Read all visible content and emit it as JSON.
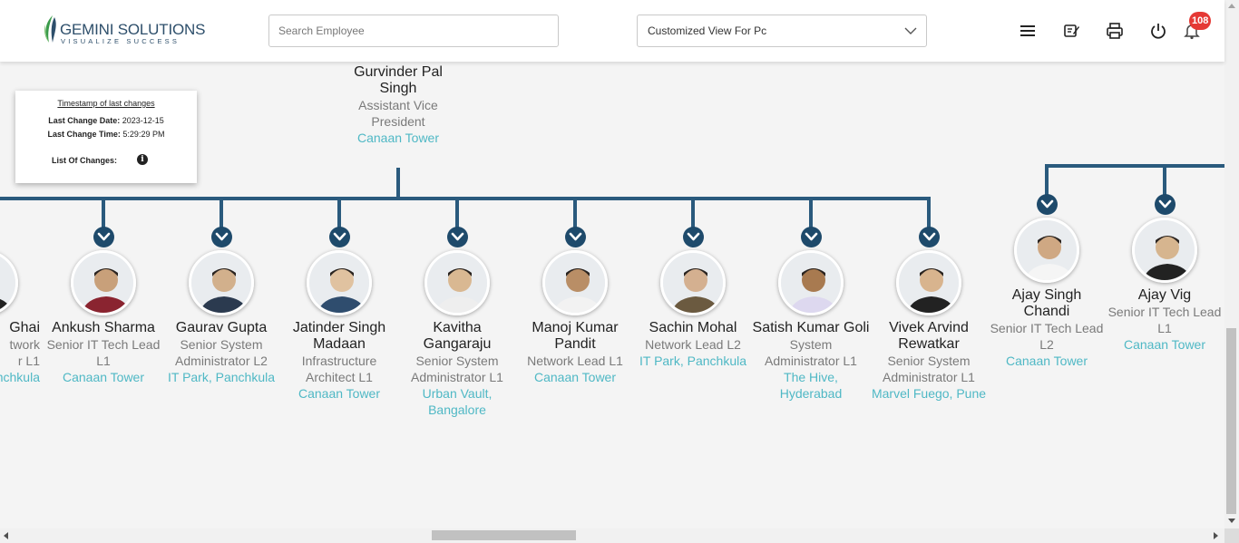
{
  "header": {
    "logo_main": "GEMINI SOLUTIONS",
    "logo_sub": "VISUALIZE SUCCESS",
    "search_placeholder": "Search Employee",
    "view_select": "Customized View For Pc",
    "notification_count": "108",
    "icons": [
      "menu-icon",
      "edit-note-icon",
      "print-icon",
      "power-icon",
      "bell-icon"
    ]
  },
  "timestamp": {
    "title": "Timestamp of last changes",
    "date_label": "Last Change Date:",
    "date_value": "2023-12-15",
    "time_label": "Last Change Time:",
    "time_value": "5:29:29 PM",
    "changes_label": "List Of Changes:"
  },
  "manager": {
    "name": "Gurvinder Pal Singh",
    "title": "Assistant Vice President",
    "location": "Canaan Tower"
  },
  "reports": [
    {
      "name": "Ghai",
      "title": "twork",
      "title2": "r L1",
      "location": "nchkula"
    },
    {
      "name": "Ankush Sharma",
      "title": "Senior IT Tech Lead L1",
      "location": "Canaan Tower"
    },
    {
      "name": "Gaurav Gupta",
      "title": "Senior System Administrator L2",
      "location": "IT Park, Panchkula"
    },
    {
      "name": "Jatinder Singh Madaan",
      "title": "Infrastructure Architect L1",
      "location": "Canaan Tower"
    },
    {
      "name": "Kavitha Gangaraju",
      "title": "Senior System Administrator L1",
      "location": "Urban Vault, Bangalore"
    },
    {
      "name": "Manoj Kumar Pandit",
      "title": "Network Lead L1",
      "location": "Canaan Tower"
    },
    {
      "name": "Sachin Mohal",
      "title": "Network Lead L2",
      "location": "IT Park, Panchkula"
    },
    {
      "name": "Satish Kumar Goli",
      "title": "System Administrator L1",
      "location": "The Hive, Hyderabad"
    },
    {
      "name": "Vivek Arvind Rewatkar",
      "title": "Senior System Administrator L1",
      "location": "Marvel Fuego, Pune"
    }
  ],
  "second_group": [
    {
      "name": "Ajay Singh Chandi",
      "title": "Senior IT Tech Lead L2",
      "location": "Canaan Tower"
    },
    {
      "name": "Ajay Vig",
      "title": "Senior IT Tech Lead L1",
      "location": "Canaan Tower"
    }
  ]
}
